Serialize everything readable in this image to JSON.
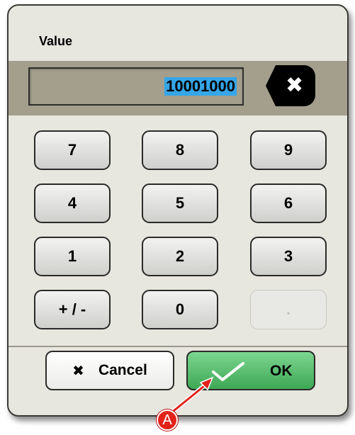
{
  "dialog": {
    "value_label": "Value",
    "value": "10001000",
    "backspace_glyph": "✖"
  },
  "keypad": {
    "rows": [
      [
        "7",
        "8",
        "9"
      ],
      [
        "4",
        "5",
        "6"
      ],
      [
        "1",
        "2",
        "3"
      ],
      [
        "+ / -",
        "0",
        "."
      ]
    ],
    "disabled_keys": [
      "."
    ]
  },
  "footer": {
    "cancel_icon": "✖",
    "cancel_label": "Cancel",
    "ok_label": "OK"
  },
  "annotation": {
    "badge": "A"
  },
  "colors": {
    "value_highlight": "#35a6e8",
    "ok_green": "#3ea855",
    "annotation_red": "#e2231a"
  }
}
